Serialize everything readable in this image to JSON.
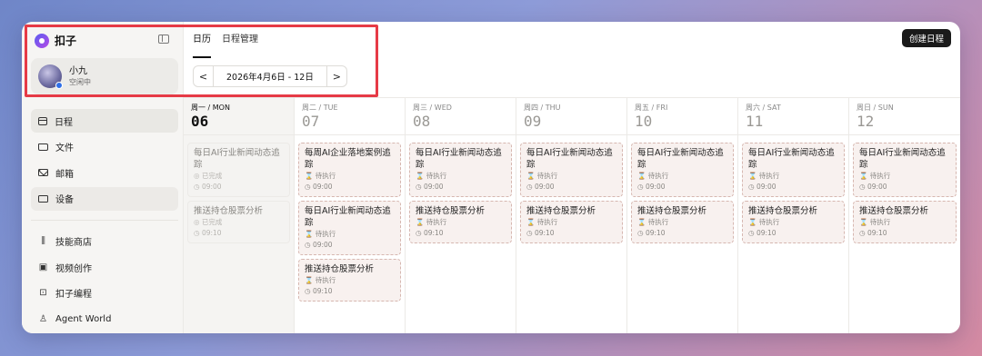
{
  "brand": {
    "name": "扣子"
  },
  "user": {
    "name": "小九",
    "status": "空闲中"
  },
  "nav": {
    "items": [
      {
        "label": "日程",
        "icon": "calendar-icon",
        "active": true
      },
      {
        "label": "文件",
        "icon": "folder-icon"
      },
      {
        "label": "邮箱",
        "icon": "mail-icon"
      },
      {
        "label": "设备",
        "icon": "device-icon"
      }
    ],
    "items2": [
      {
        "label": "技能商店",
        "icon": "skill-store-icon"
      },
      {
        "label": "视频创作",
        "icon": "video-icon"
      },
      {
        "label": "扣子编程",
        "icon": "code-icon"
      },
      {
        "label": "Agent World",
        "icon": "agent-icon"
      }
    ]
  },
  "tabs": [
    {
      "label": "日历",
      "active": true
    },
    {
      "label": "日程管理"
    }
  ],
  "week": {
    "range": "2026年4月6日 - 12日",
    "prev": "<",
    "next": ">"
  },
  "create_button": "创建日程",
  "days": [
    {
      "dow": "周一 / MON",
      "num": "06",
      "today": true,
      "events": [
        {
          "title": "每日AI行业新闻动态追踪",
          "status": "已完成",
          "time": "09:00",
          "done": true
        },
        {
          "title": "推送持仓股票分析",
          "status": "已完成",
          "time": "09:10",
          "done": true
        }
      ]
    },
    {
      "dow": "周二 / TUE",
      "num": "07",
      "events": [
        {
          "title": "每周AI企业落地案例追踪",
          "status": "待执行",
          "time": "09:00"
        },
        {
          "title": "每日AI行业新闻动态追踪",
          "status": "待执行",
          "time": "09:00"
        },
        {
          "title": "推送持仓股票分析",
          "status": "待执行",
          "time": "09:10"
        }
      ]
    },
    {
      "dow": "周三 / WED",
      "num": "08",
      "events": [
        {
          "title": "每日AI行业新闻动态追踪",
          "status": "待执行",
          "time": "09:00"
        },
        {
          "title": "推送持仓股票分析",
          "status": "待执行",
          "time": "09:10"
        }
      ]
    },
    {
      "dow": "周四 / THU",
      "num": "09",
      "events": [
        {
          "title": "每日AI行业新闻动态追踪",
          "status": "待执行",
          "time": "09:00"
        },
        {
          "title": "推送持仓股票分析",
          "status": "待执行",
          "time": "09:10"
        }
      ]
    },
    {
      "dow": "周五 / FRI",
      "num": "10",
      "events": [
        {
          "title": "每日AI行业新闻动态追踪",
          "status": "待执行",
          "time": "09:00"
        },
        {
          "title": "推送持仓股票分析",
          "status": "待执行",
          "time": "09:10"
        }
      ]
    },
    {
      "dow": "周六 / SAT",
      "num": "11",
      "events": [
        {
          "title": "每日AI行业新闻动态追踪",
          "status": "待执行",
          "time": "09:00"
        },
        {
          "title": "推送持仓股票分析",
          "status": "待执行",
          "time": "09:10"
        }
      ]
    },
    {
      "dow": "周日 / SUN",
      "num": "12",
      "events": [
        {
          "title": "每日AI行业新闻动态追踪",
          "status": "待执行",
          "time": "09:00"
        },
        {
          "title": "推送持仓股票分析",
          "status": "待执行",
          "time": "09:10"
        }
      ]
    }
  ],
  "colors": {
    "accent": "#1a1a1a",
    "highlight": "#e63a46",
    "pending_border": "#d6b7b0"
  }
}
